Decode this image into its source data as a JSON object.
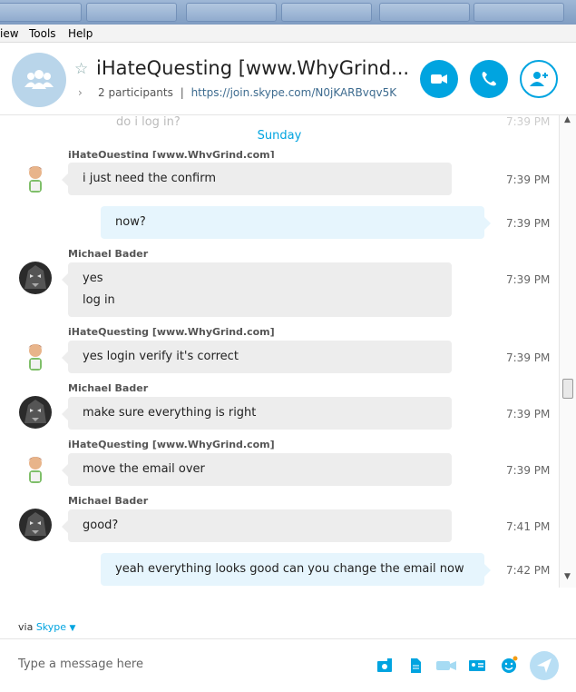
{
  "menu": {
    "view": "iew",
    "tools": "Tools",
    "help": "Help"
  },
  "header": {
    "title": "iHateQuesting [www.WhyGrind....",
    "participants": "2 participants",
    "separator": "|",
    "link": "https://join.skype.com/N0jKARBvqv5K"
  },
  "chat": {
    "faded_text": "do i log in?",
    "faded_time": "7:39 PM",
    "day_divider": "Sunday",
    "messages": [
      {
        "sender": "iHateQuesting [www.WhyGrind.com]",
        "lines": [
          "i just need the confirm"
        ],
        "time": "7:39 PM"
      },
      {
        "sender": "",
        "lines": [
          "now?"
        ],
        "time": "7:39 PM"
      },
      {
        "sender": "Michael Bader",
        "lines": [
          "yes",
          "log in"
        ],
        "time": "7:39 PM"
      },
      {
        "sender": "iHateQuesting [www.WhyGrind.com]",
        "lines": [
          "yes login verify it's correct"
        ],
        "time": "7:39 PM"
      },
      {
        "sender": "Michael Bader",
        "lines": [
          "make sure everything is right"
        ],
        "time": "7:39 PM"
      },
      {
        "sender": "iHateQuesting [www.WhyGrind.com]",
        "lines": [
          "move the email over"
        ],
        "time": "7:39 PM"
      },
      {
        "sender": "Michael Bader",
        "lines": [
          "good?"
        ],
        "time": "7:41 PM"
      },
      {
        "sender": "",
        "lines": [
          "yeah everything looks good can you change the email now"
        ],
        "time": "7:42 PM"
      }
    ]
  },
  "composer": {
    "via_label": "via",
    "via_service": "Skype",
    "placeholder": "Type a message here"
  },
  "colors": {
    "accent": "#00a4e0",
    "bubble_in": "#ededed",
    "bubble_out": "#e6f5fd"
  },
  "icons": [
    "group-avatar-icon",
    "star-icon",
    "video-call-icon",
    "audio-call-icon",
    "add-participant-icon",
    "media-icon",
    "file-icon",
    "video-message-icon",
    "contact-card-icon",
    "emoticon-icon",
    "send-icon"
  ]
}
